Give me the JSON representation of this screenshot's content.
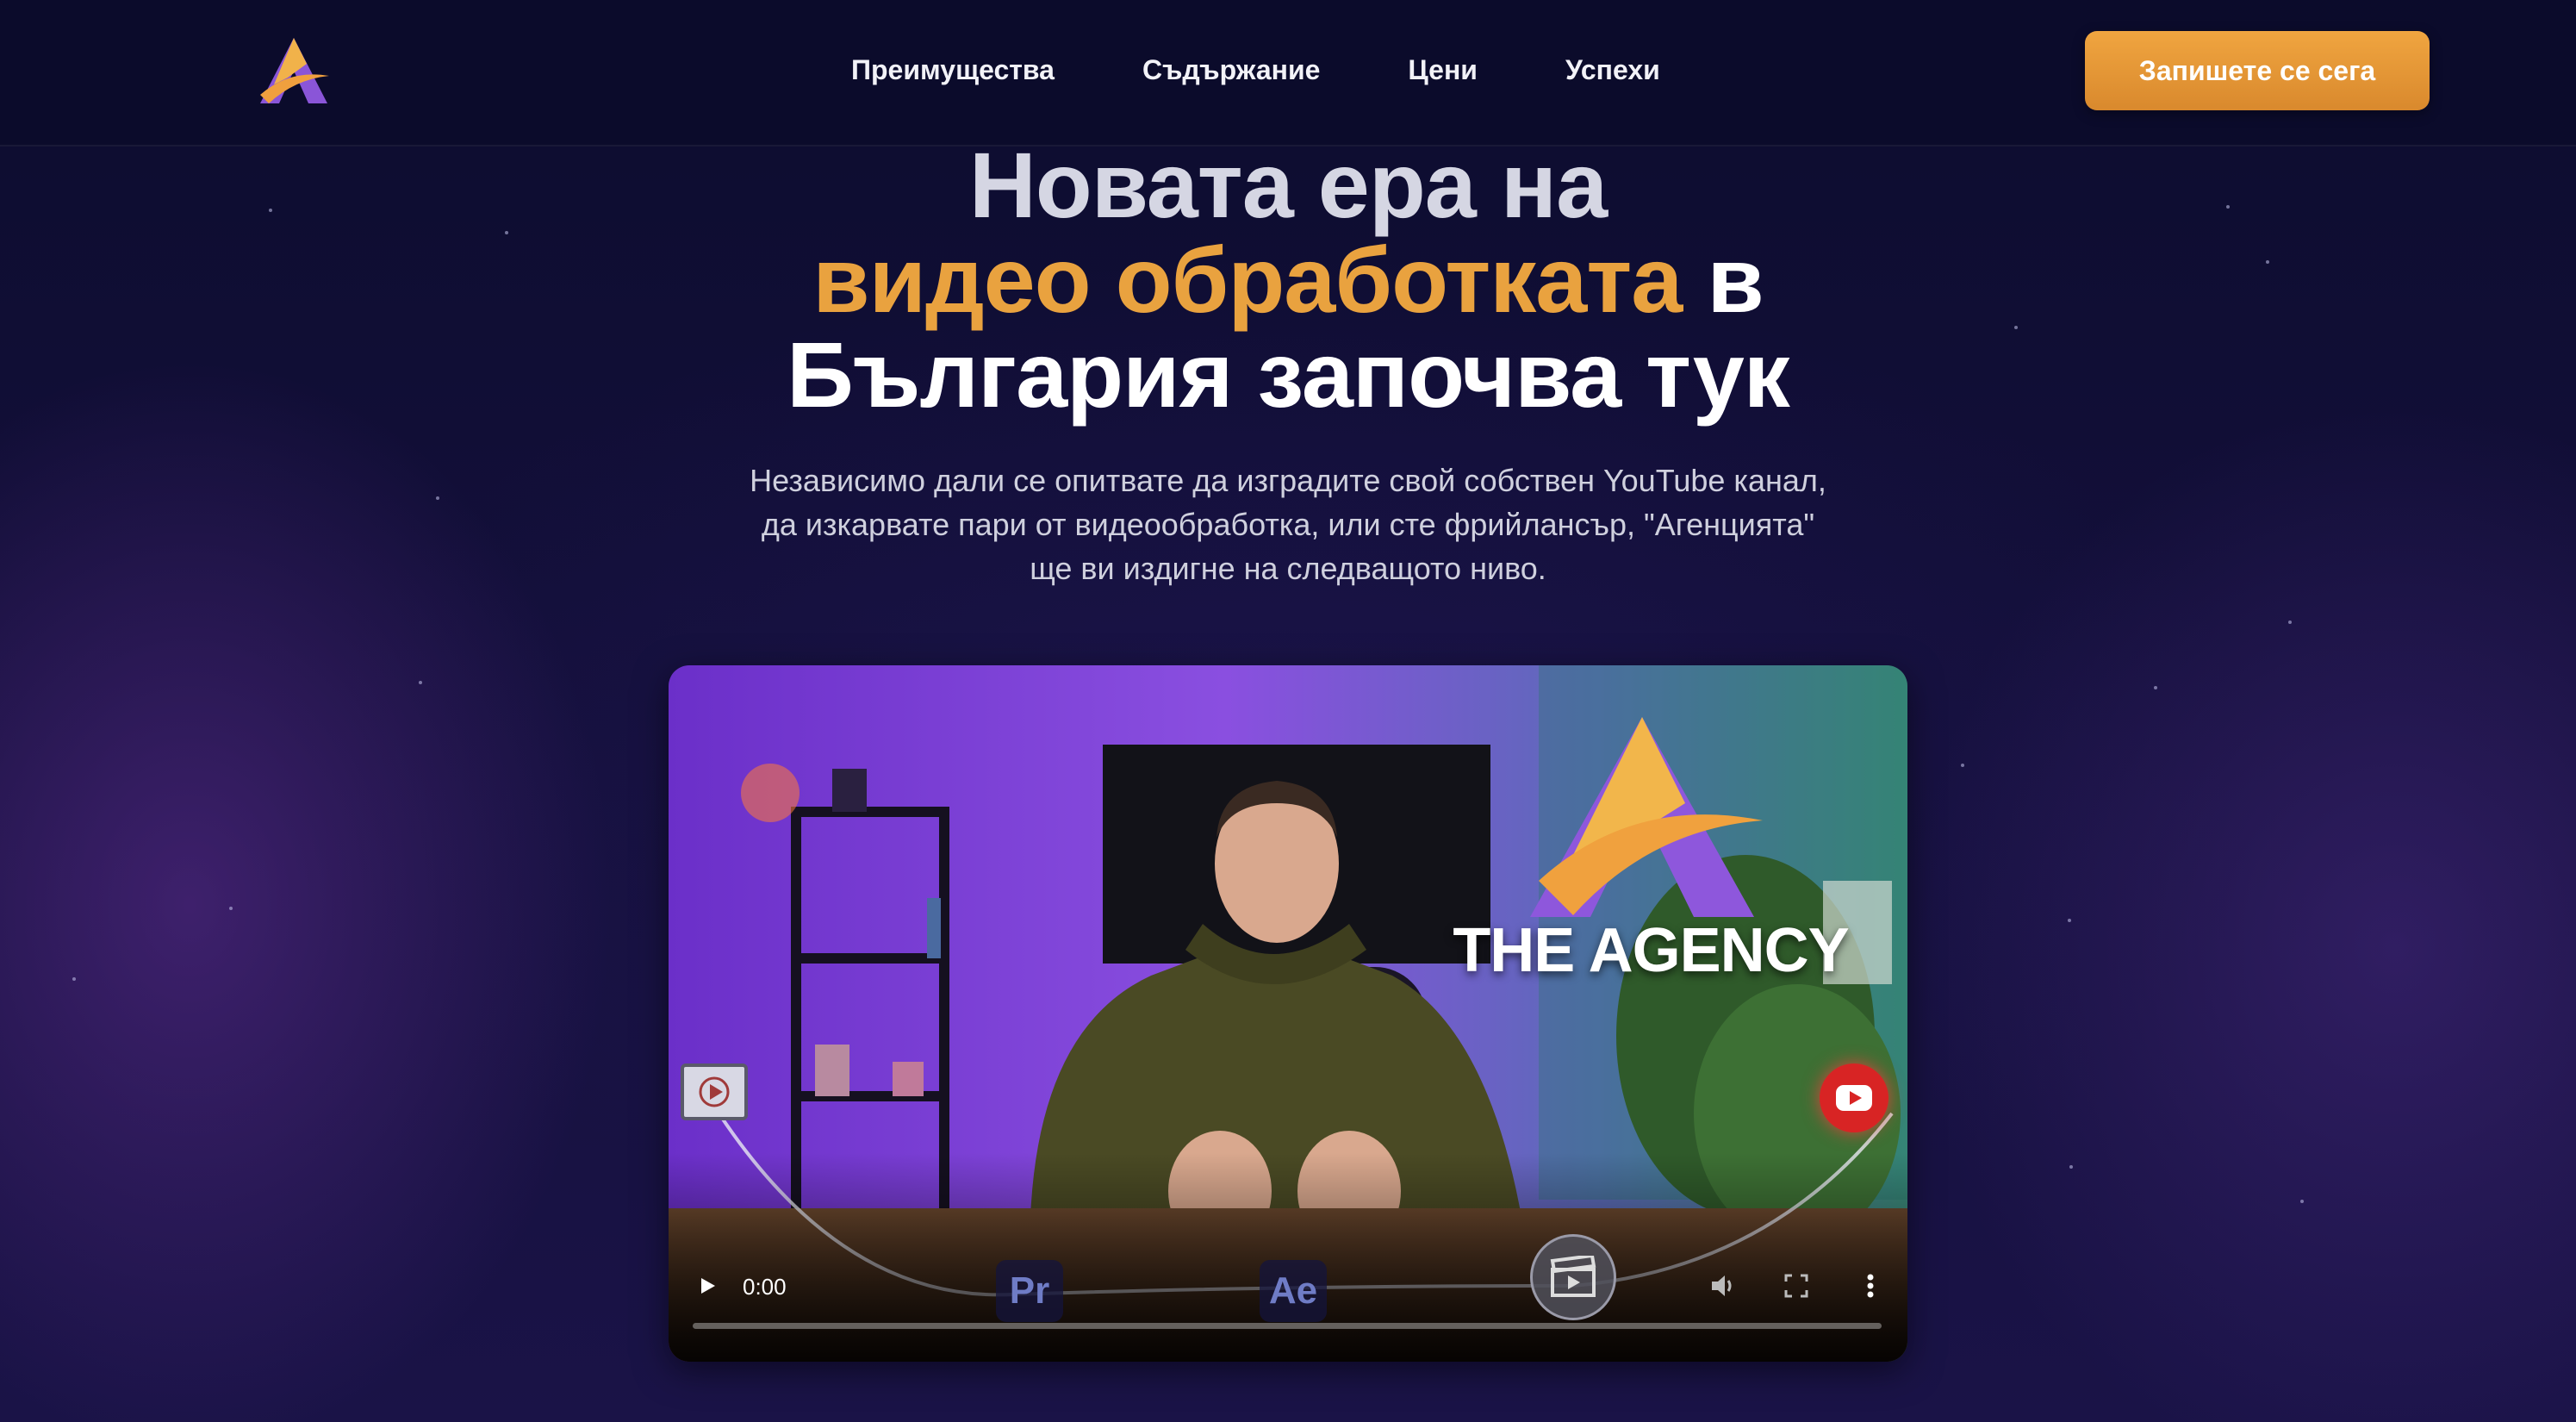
{
  "nav": {
    "links": [
      "Преимущества",
      "Съдържание",
      "Цени",
      "Успехи"
    ],
    "cta_label": "Запишете се сега"
  },
  "hero": {
    "title_line1": "Новата ера на",
    "title_line2_accent": "видео обработката",
    "title_line2_rest": " в",
    "title_line3": "България започва тук",
    "subtitle": "Независимо дали се опитвате да изградите свой собствен YouTube канал, да изкарвате пари от видеообработка, или сте фрийлансър, \"Агенцията\" ще ви издигне на следващото ниво."
  },
  "video": {
    "brand_text": "THE AGENCY",
    "current_time": "0:00",
    "progress": 0,
    "badges": [
      "Pr",
      "Ae"
    ]
  },
  "colors": {
    "accent": "#e9a23f",
    "background": "#0c0c2e",
    "cta": "#e39a38"
  }
}
